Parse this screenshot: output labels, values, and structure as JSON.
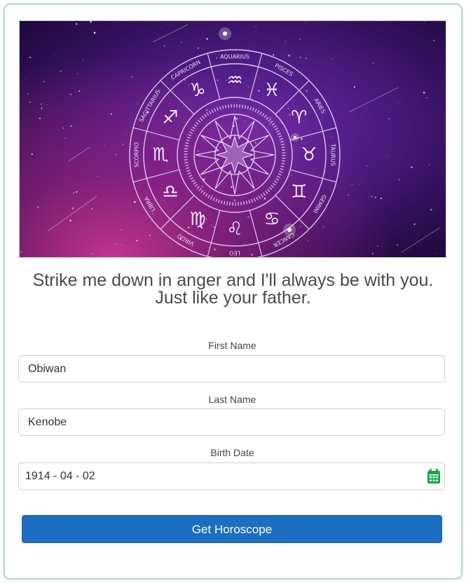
{
  "hero": {
    "signs": [
      "AQUARIUS",
      "PISCES",
      "ARIES",
      "TAURUS",
      "GEMINI",
      "CANCER",
      "LEO",
      "VIRGO",
      "LIBRA",
      "SCORPIO",
      "SAGITTARIUS",
      "CAPRICORN"
    ],
    "glyphs": [
      "♒",
      "♓",
      "♈",
      "♉",
      "♊",
      "♋",
      "♌",
      "♍",
      "♎",
      "♏",
      "♐",
      "♑"
    ]
  },
  "quote": {
    "line1": "Strike me down in anger and I'll always be with you.",
    "line2": "Just like your father."
  },
  "form": {
    "first_name": {
      "label": "First Name",
      "value": "Obiwan"
    },
    "last_name": {
      "label": "Last Name",
      "value": "Kenobe"
    },
    "birth_date": {
      "label": "Birth Date",
      "value": "1914 - 04 - 02"
    },
    "submit_label": "Get Horoscope"
  },
  "colors": {
    "button": "#1b6ec2",
    "calendar_icon": "#19a74a",
    "card_border": "#b9dcc3"
  },
  "icons": {
    "date_picker": "calendar-icon"
  }
}
